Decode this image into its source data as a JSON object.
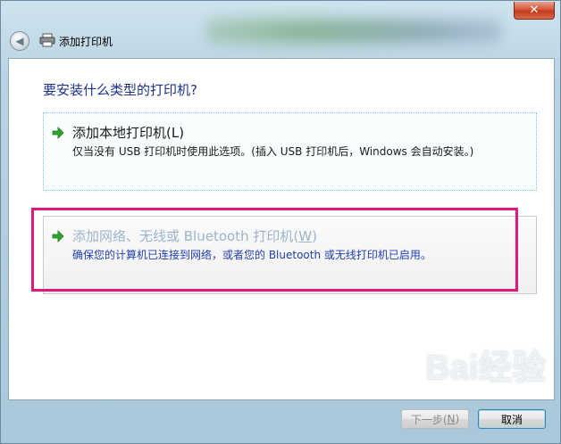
{
  "window": {
    "title": "添加打印机",
    "close_label": "✕"
  },
  "main": {
    "heading": "要安装什么类型的打印机?",
    "options": [
      {
        "title_pre": "添加本地打印机(",
        "title_key": "L",
        "title_post": ")",
        "desc": "仅当没有 USB 打印机时使用此选项。(插入 USB 打印机后，Windows 会自动安装。)"
      },
      {
        "title_pre": "添加网络、无线或 Bluetooth 打印机(",
        "title_key": "W",
        "title_post": ")",
        "desc": "确保您的计算机已连接到网络，或者您的 Bluetooth 或无线打印机已启用。"
      }
    ]
  },
  "footer": {
    "next_pre": "下一步(",
    "next_key": "N",
    "next_post": ")",
    "cancel_label": "取消"
  },
  "watermark": "Bai经验",
  "colors": {
    "heading": "#1e3287",
    "highlight": "#e2177a",
    "link_desc": "#1f3fb0"
  }
}
